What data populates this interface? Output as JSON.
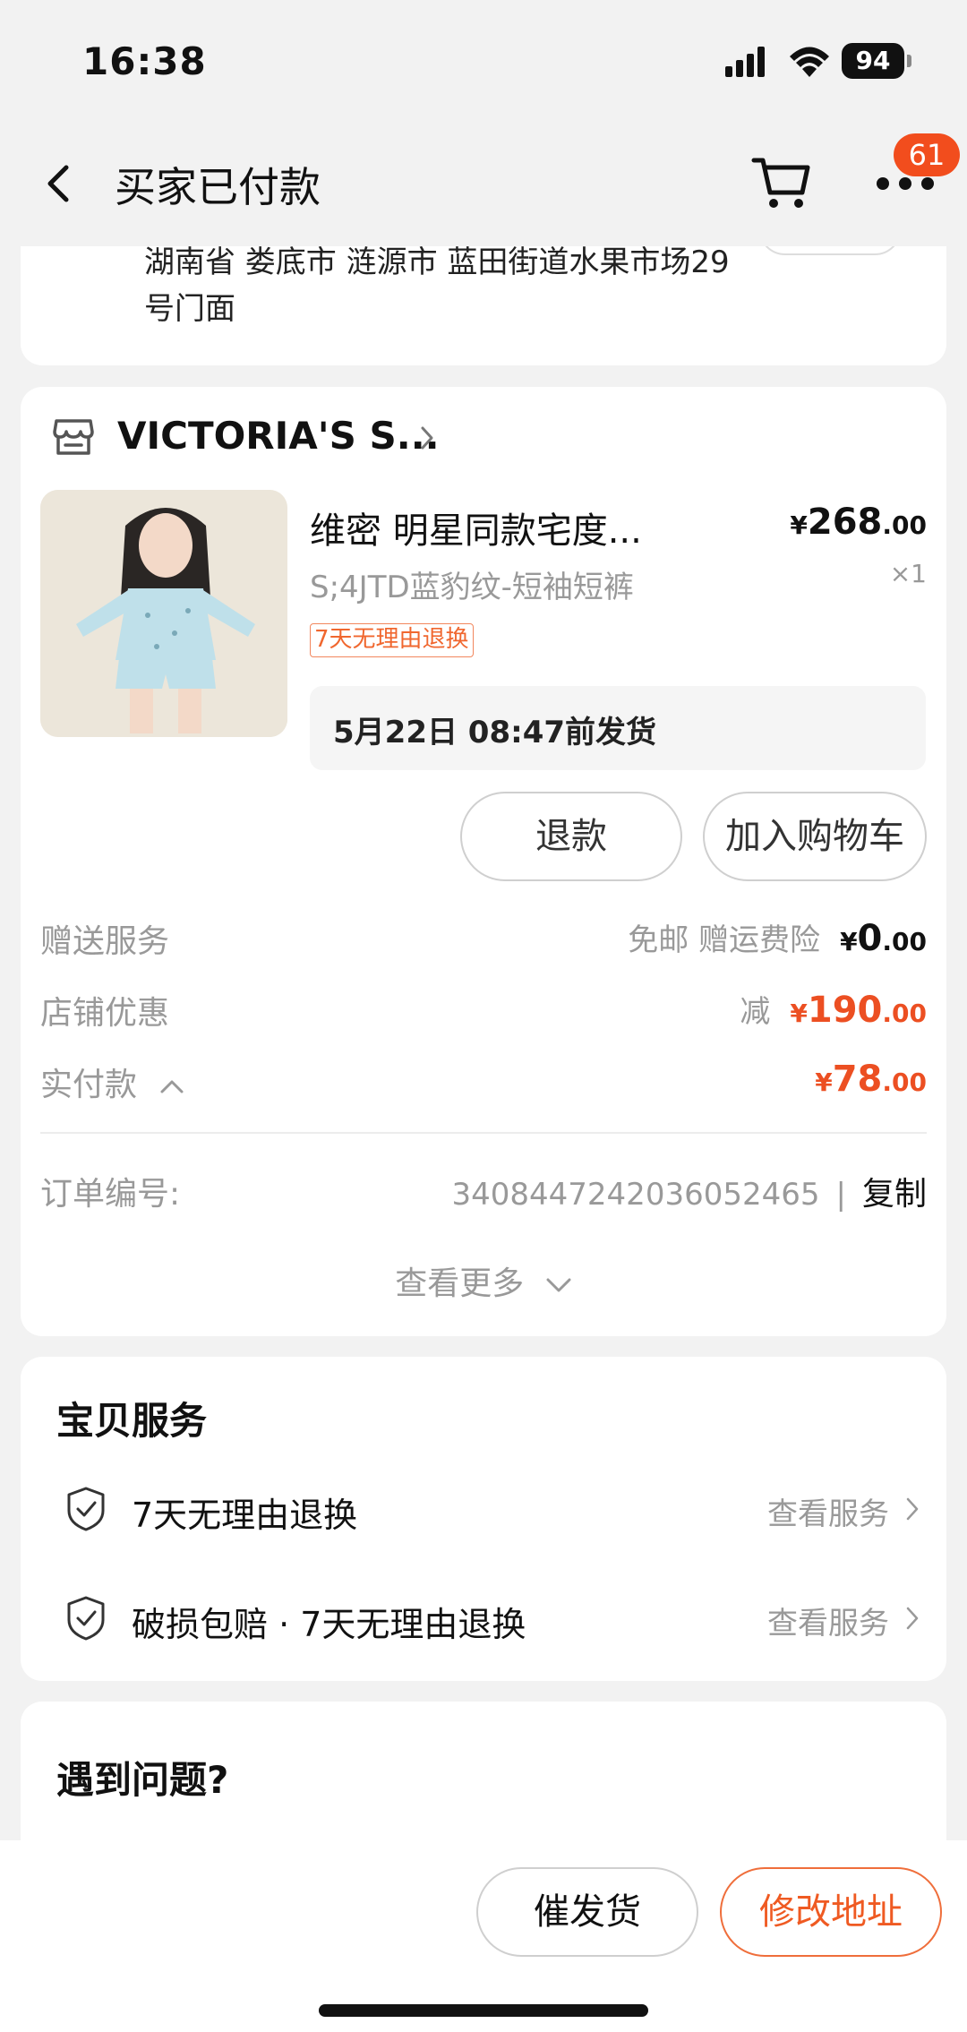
{
  "status_bar": {
    "time": "16:38",
    "battery": "94"
  },
  "nav": {
    "title": "买家已付款",
    "badge_count": "61",
    "icons": [
      "back-icon",
      "cart-icon",
      "more-icon"
    ]
  },
  "address": {
    "text": "湖南省 娄底市 涟源市 蓝田街道水果市场29号门面"
  },
  "order": {
    "store_name": "VICTORIA'S S...",
    "product": {
      "title": "维密 明星同款宅度...",
      "price_currency": "¥",
      "price_int": "268",
      "price_dec": ".00",
      "sku": "S;4JTD蓝豹纹-短袖短裤",
      "qty": "×1",
      "return_tag": "7天无理由退换",
      "ship_time": "5月22日 08:47前发货"
    },
    "buttons": {
      "refund": "退款",
      "add_to_cart": "加入购物车"
    },
    "gift": {
      "label": "赠送服务",
      "note": "免邮 赠运费险",
      "currency": "¥",
      "int": "0",
      "dec": ".00"
    },
    "discount": {
      "label": "店铺优惠",
      "minus": "减",
      "currency": "¥",
      "int": "190",
      "dec": ".00"
    },
    "paid": {
      "label": "实付款",
      "currency": "¥",
      "int": "78",
      "dec": ".00"
    },
    "order_no": {
      "label": "订单编号:",
      "value": "3408447242036052465",
      "separator": "|",
      "copy": "复制"
    },
    "view_more": "查看更多"
  },
  "service": {
    "heading": "宝贝服务",
    "items": [
      {
        "text": "7天无理由退换",
        "link": "查看服务"
      },
      {
        "text": "破损包赔 · 7天无理由退换",
        "link": "查看服务"
      }
    ]
  },
  "problem": {
    "heading": "遇到问题?"
  },
  "bottom": {
    "urge": "催发货",
    "modify_address": "修改地址"
  },
  "colors": {
    "accent": "#ec4f22",
    "badge": "#f24d1d",
    "muted": "#999999",
    "background": "#f2f2f2"
  }
}
